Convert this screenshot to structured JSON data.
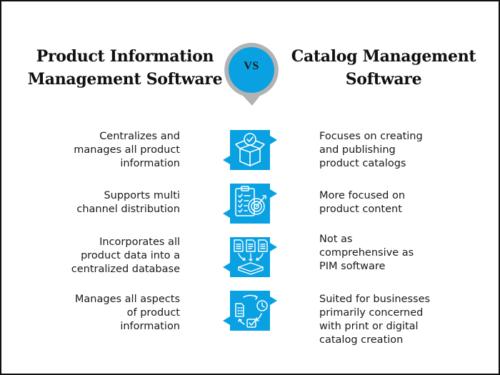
{
  "colors": {
    "accent": "#0aa1e2",
    "ring": "#b3b3b3",
    "text": "#1a1a1a",
    "border": "#111111"
  },
  "header": {
    "left_title_line1": "Product Information",
    "left_title_line2": "Management Software",
    "vs_label": "VS",
    "right_title_line1": "Catalog Management",
    "right_title_line2": "Software"
  },
  "rows": [
    {
      "icon": "box-checkmark-icon",
      "left": [
        "Centralizes and",
        "manages all product",
        "information"
      ],
      "right": [
        "Focuses on creating",
        "and publishing",
        "product catalogs"
      ]
    },
    {
      "icon": "clipboard-target-icon",
      "left": [
        "Supports multi",
        "channel distribution"
      ],
      "right": [
        "More focused on",
        "product content"
      ]
    },
    {
      "icon": "documents-to-database-icon",
      "left": [
        "Incorporates all",
        "product data into a",
        "centralized database"
      ],
      "right": [
        "Not as",
        "comprehensive as",
        "PIM software"
      ]
    },
    {
      "icon": "workflow-cycle-icon",
      "left": [
        "Manages all aspects",
        "of product",
        "information"
      ],
      "right": [
        "Suited for businesses",
        "primarily concerned",
        "with print or digital",
        "catalog creation"
      ]
    }
  ]
}
